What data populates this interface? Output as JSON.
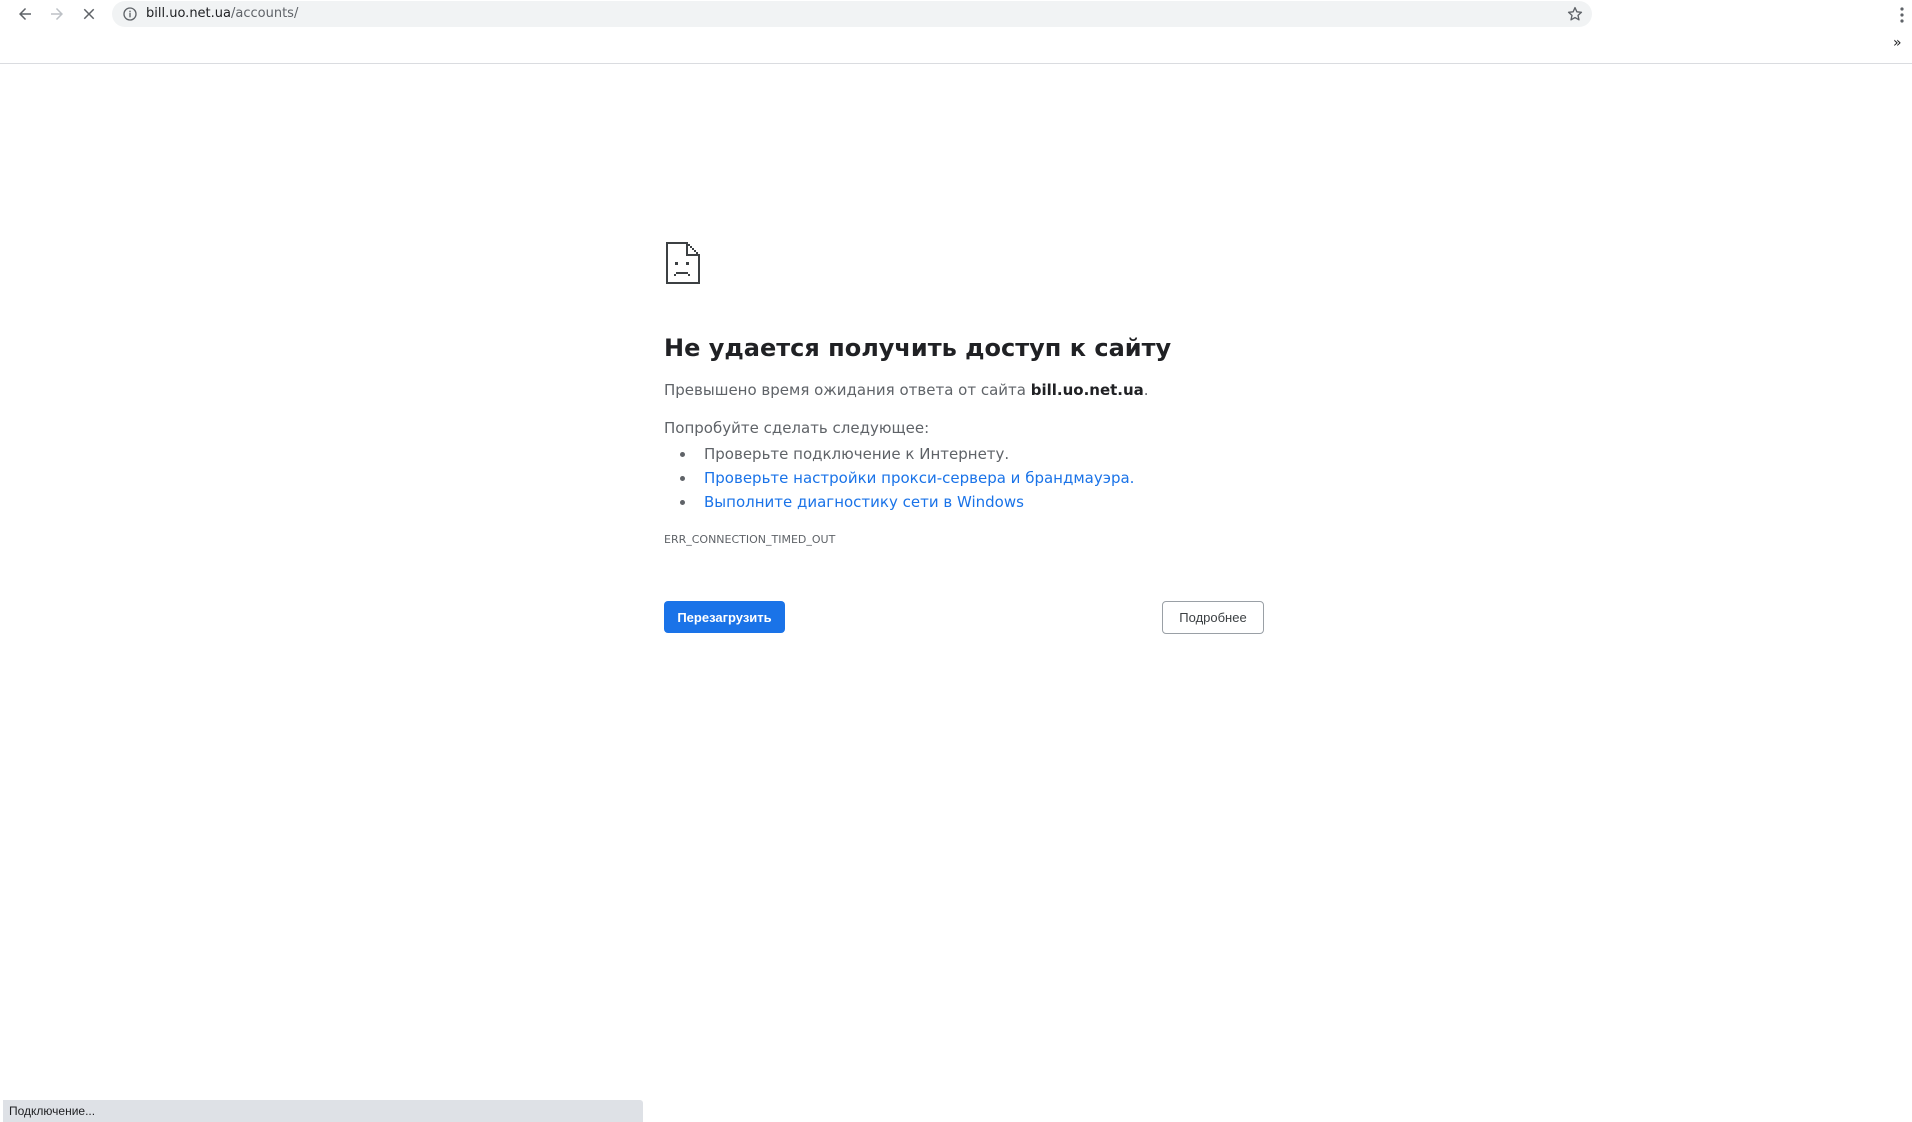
{
  "browser": {
    "url_host": "bill.uo.net.ua",
    "url_path": "/accounts/",
    "back_icon": "back-arrow-icon",
    "forward_icon": "forward-arrow-icon",
    "stop_icon": "stop-loading-icon",
    "info_icon": "info-icon",
    "star_icon": "star-icon",
    "menu_icon": "more-vert-icon",
    "bookmarks_overflow": "»"
  },
  "error_page": {
    "icon": "sad-page-icon",
    "title": "Не удается получить доступ к сайту",
    "summary_prefix": "Превышено время ожидания ответа от сайта ",
    "summary_host": "bill.uo.net.ua",
    "summary_suffix": ".",
    "try_label": "Попробуйте сделать следующее:",
    "suggestions": [
      {
        "text": "Проверьте подключение к Интернету.",
        "is_link": false
      },
      {
        "text": "Проверьте настройки прокси-сервера и брандмауэра.",
        "is_link": true
      },
      {
        "text": "Выполните диагностику сети в Windows",
        "is_link": true
      }
    ],
    "error_code": "ERR_CONNECTION_TIMED_OUT",
    "reload_label": "Перезагрузить",
    "details_label": "Подробнее"
  },
  "status_bar": {
    "text": "Подключение..."
  },
  "colors": {
    "primary_button": "#1a73e8",
    "link": "#1a73e8",
    "text": "#202124",
    "secondary_text": "#5f6368",
    "omnibox_bg": "#f1f3f4"
  }
}
